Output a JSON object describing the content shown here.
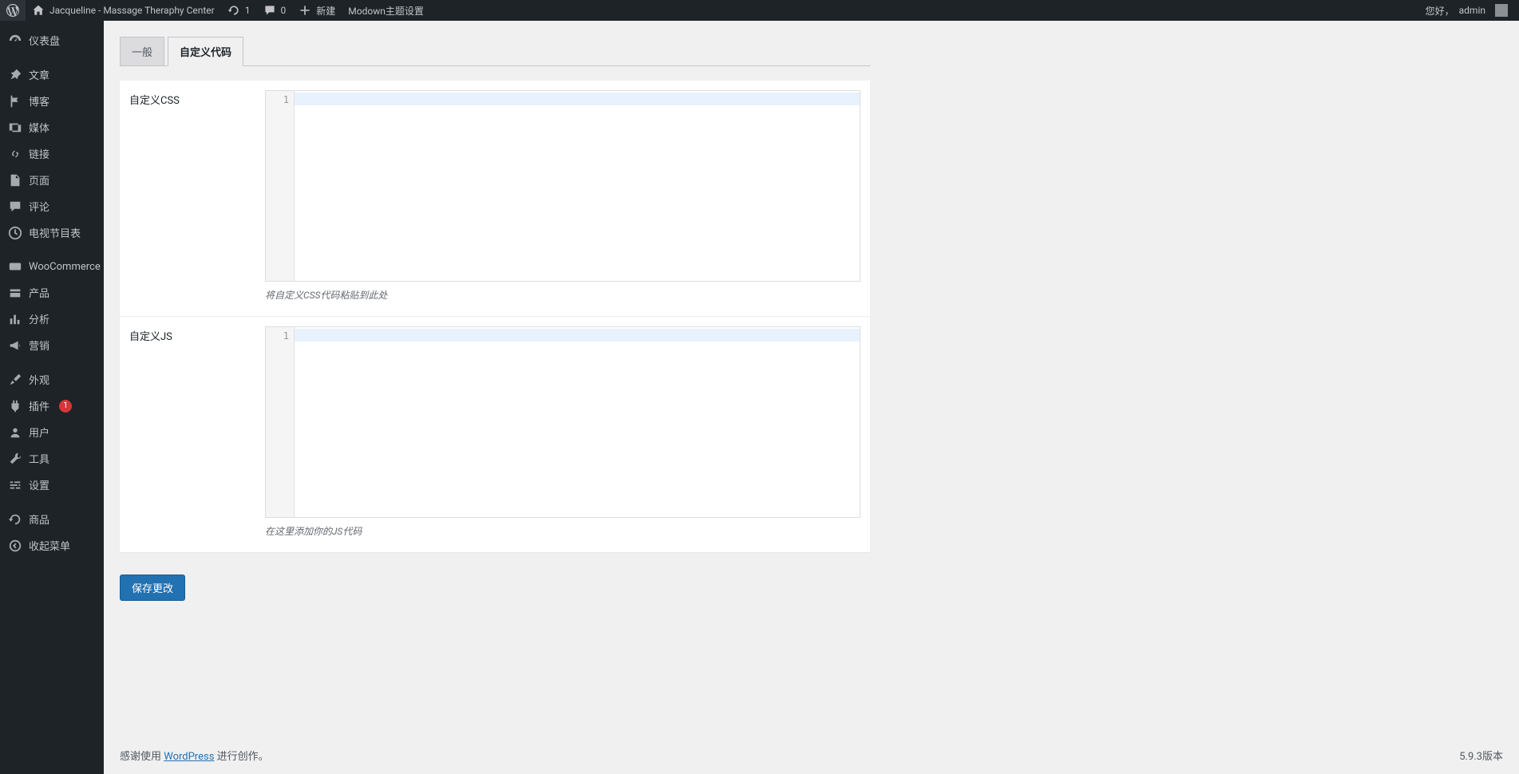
{
  "adminbar": {
    "site_title": "Jacqueline - Massage Theraphy Center",
    "refresh_count": "1",
    "comments_count": "0",
    "new_label": "新建",
    "theme_settings": "Modown主题设置",
    "greeting": "您好，",
    "user": "admin"
  },
  "sidebar": {
    "items": [
      {
        "label": "仪表盘"
      },
      {
        "label": "文章"
      },
      {
        "label": "博客"
      },
      {
        "label": "媒体"
      },
      {
        "label": "链接"
      },
      {
        "label": "页面"
      },
      {
        "label": "评论"
      },
      {
        "label": "电视节目表"
      },
      {
        "label": "WooCommerce"
      },
      {
        "label": "产品"
      },
      {
        "label": "分析"
      },
      {
        "label": "营销"
      },
      {
        "label": "外观"
      },
      {
        "label": "插件",
        "badge": "1"
      },
      {
        "label": "用户"
      },
      {
        "label": "工具"
      },
      {
        "label": "设置"
      },
      {
        "label": "商品"
      },
      {
        "label": "收起菜单"
      }
    ]
  },
  "tabs": {
    "general": "一般",
    "custom_code": "自定义代码"
  },
  "fields": {
    "css": {
      "label": "自定义CSS",
      "gutter": "1",
      "desc": "将自定义CSS代码粘贴到此处"
    },
    "js": {
      "label": "自定义JS",
      "gutter": "1",
      "desc": "在这里添加你的JS代码"
    }
  },
  "actions": {
    "save": "保存更改"
  },
  "footer": {
    "thanks_prefix": "感谢使用 ",
    "wp": "WordPress",
    "thanks_suffix": " 进行创作。",
    "version": "5.9.3版本"
  }
}
